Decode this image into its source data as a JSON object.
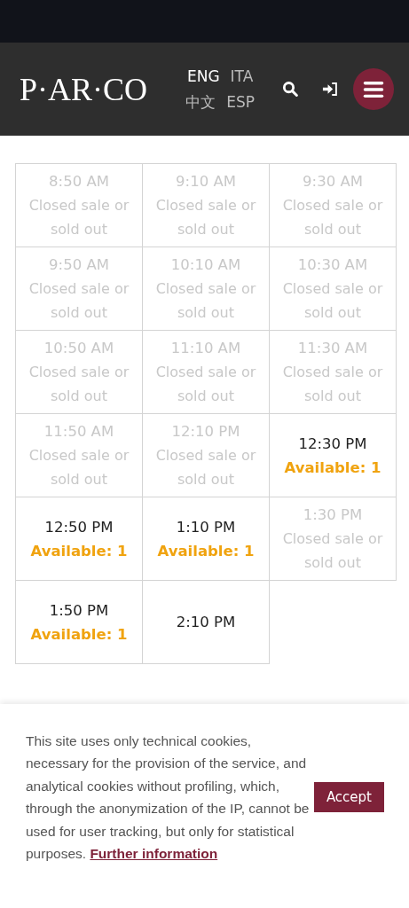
{
  "header": {
    "logo": "P·AR·CO",
    "languages": [
      {
        "label": "ENG",
        "selected": true
      },
      {
        "label": "ITA",
        "selected": false
      },
      {
        "label": "中文",
        "selected": false
      },
      {
        "label": "ESP",
        "selected": false
      }
    ]
  },
  "slots": [
    {
      "time": "8:50 AM",
      "kind": "closed",
      "status": "Closed sale or sold out"
    },
    {
      "time": "9:10 AM",
      "kind": "closed",
      "status": "Closed sale or sold out"
    },
    {
      "time": "9:30 AM",
      "kind": "closed",
      "status": "Closed sale or sold out"
    },
    {
      "time": "9:50 AM",
      "kind": "closed",
      "status": "Closed sale or sold out"
    },
    {
      "time": "10:10 AM",
      "kind": "closed",
      "status": "Closed sale or sold out"
    },
    {
      "time": "10:30 AM",
      "kind": "closed",
      "status": "Closed sale or sold out"
    },
    {
      "time": "10:50 AM",
      "kind": "closed",
      "status": "Closed sale or sold out"
    },
    {
      "time": "11:10 AM",
      "kind": "closed",
      "status": "Closed sale or sold out"
    },
    {
      "time": "11:30 AM",
      "kind": "closed",
      "status": "Closed sale or sold out"
    },
    {
      "time": "11:50 AM",
      "kind": "closed",
      "status": "Closed sale or sold out"
    },
    {
      "time": "12:10 PM",
      "kind": "closed",
      "status": "Closed sale or sold out"
    },
    {
      "time": "12:30 PM",
      "kind": "available",
      "status": "Available: 1"
    },
    {
      "time": "12:50 PM",
      "kind": "available",
      "status": "Available: 1"
    },
    {
      "time": "1:10 PM",
      "kind": "available",
      "status": "Available: 1"
    },
    {
      "time": "1:30 PM",
      "kind": "closed",
      "status": "Closed sale or sold out"
    },
    {
      "time": "1:50 PM",
      "kind": "available",
      "status": "Available: 1"
    },
    {
      "time": "2:10 PM",
      "kind": "plain"
    }
  ],
  "cookie_banner": {
    "text": "This site uses only technical cookies, necessary for the provision of the service, and analytical cookies without profiling, which, through the anonymization of the IP, cannot be used for user tracking, but only for statistical purposes.",
    "link": "Further information",
    "button": "Accept"
  }
}
